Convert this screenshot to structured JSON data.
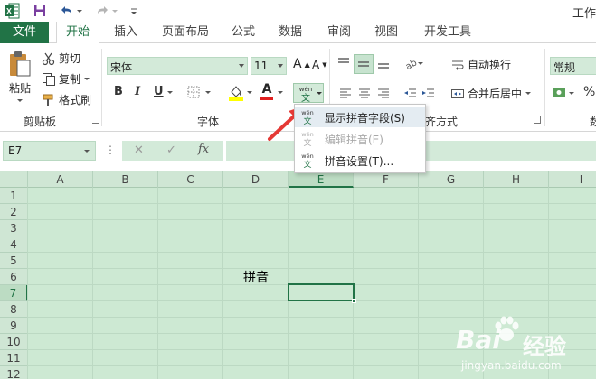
{
  "title": "工作",
  "tabs": [
    "文件",
    "开始",
    "插入",
    "页面布局",
    "公式",
    "数据",
    "审阅",
    "视图",
    "开发工具"
  ],
  "clipboard": {
    "paste": "粘贴",
    "cut": "剪切",
    "copy": "复制",
    "format_painter": "格式刷",
    "group": "剪贴板"
  },
  "font": {
    "name": "宋体",
    "size": "11",
    "bold": "B",
    "italic": "I",
    "underline": "U",
    "grow": "A",
    "shrink": "A",
    "color_letter": "A",
    "group": "字体"
  },
  "alignment": {
    "wrap": "自动换行",
    "merge": "合并后居中",
    "group": "齐方式"
  },
  "number": {
    "format": "常规",
    "percent": "%"
  },
  "formula_bar": {
    "name_box": "E7",
    "cancel": "✕",
    "enter": "✓",
    "fx": "fx",
    "more": "⋮"
  },
  "grid": {
    "columns": [
      "A",
      "B",
      "C",
      "D",
      "E",
      "F",
      "G",
      "H",
      "I"
    ],
    "rows": [
      "1",
      "2",
      "3",
      "4",
      "5",
      "6",
      "7",
      "8",
      "9",
      "10",
      "11",
      "12"
    ],
    "selected_column": "E",
    "selected_row": "7",
    "cell_d6": "拼音"
  },
  "phonetic_menu": {
    "icon_top": "wén",
    "icon_bottom": "文",
    "items": [
      {
        "label": "显示拼音字段(S)",
        "enabled": true
      },
      {
        "label": "编辑拼音(E)",
        "enabled": false
      },
      {
        "label": "拼音设置(T)...",
        "enabled": true
      }
    ]
  },
  "watermark": {
    "brand": "Bai",
    "brand_cn": "经验",
    "url": "jingyan.baidu.com"
  },
  "colors": {
    "accent": "#217346",
    "cell_bg": "#cde9d3",
    "arrow": "#e53935"
  }
}
